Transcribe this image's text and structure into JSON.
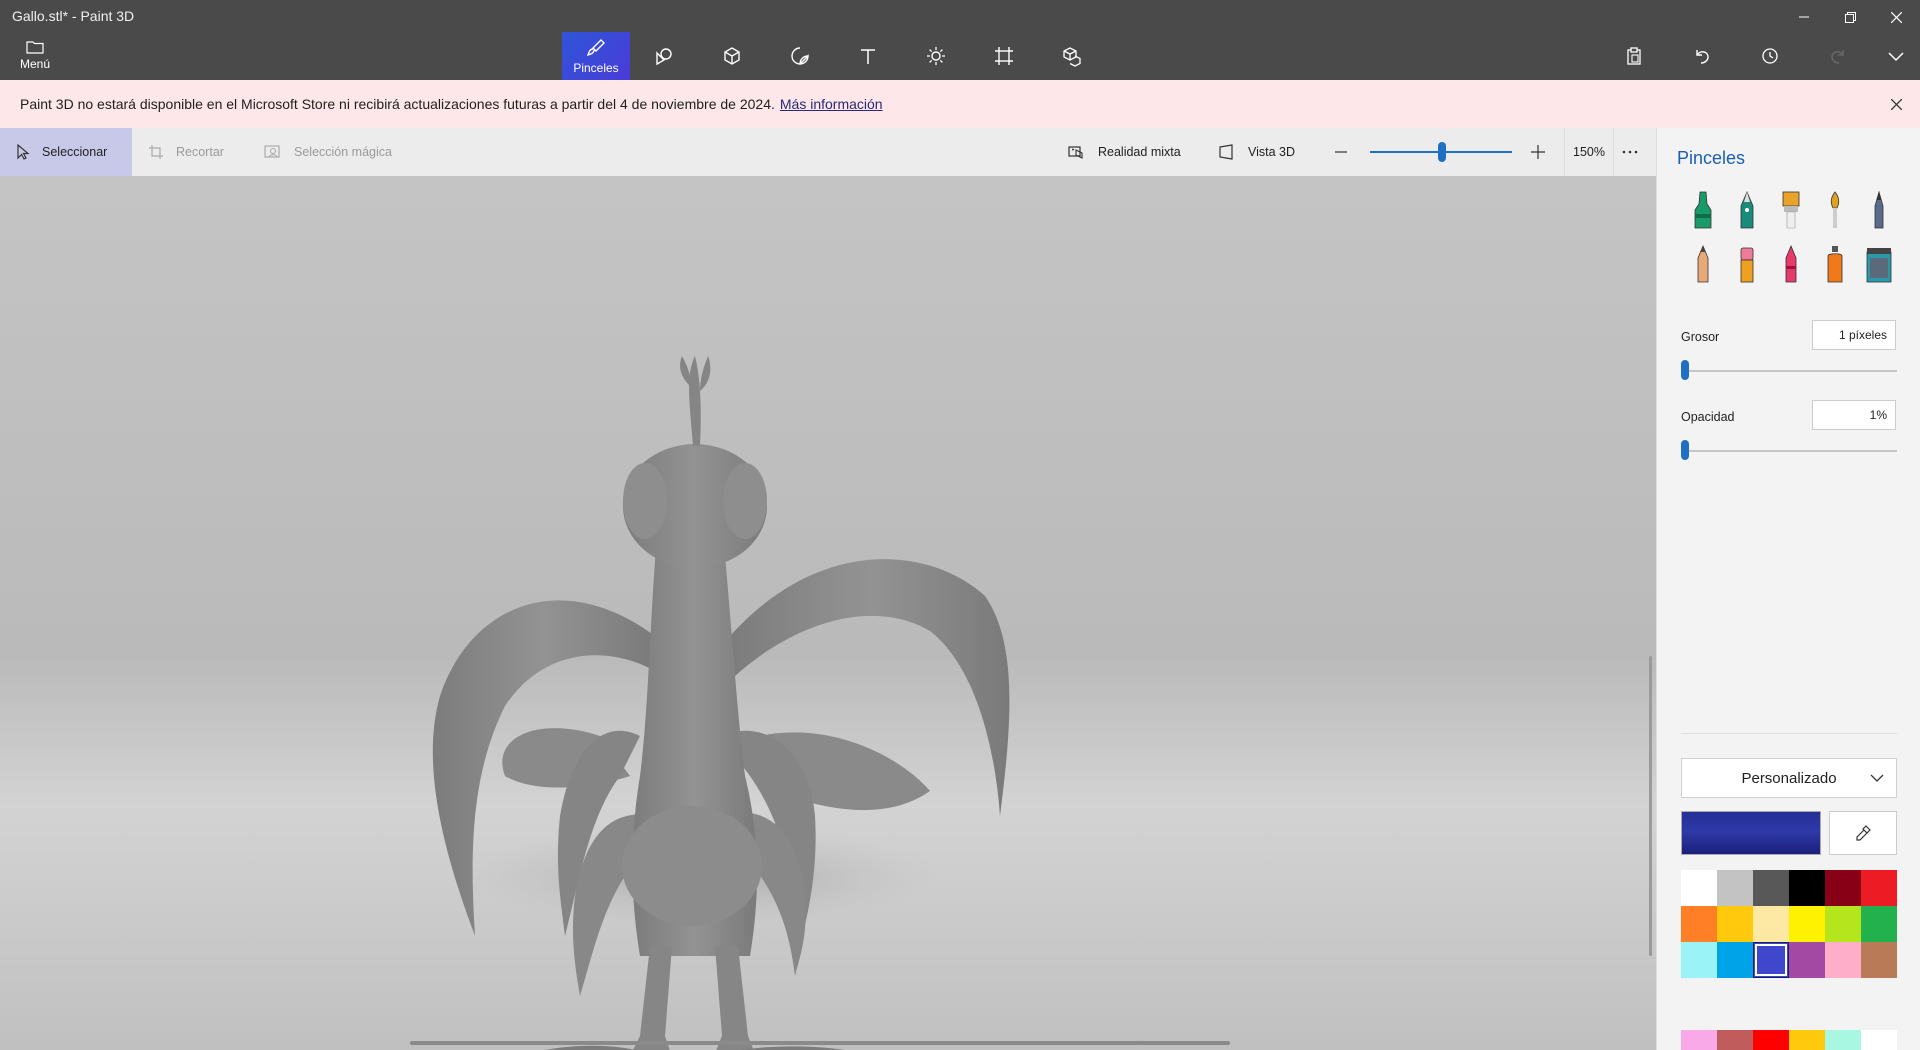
{
  "window": {
    "title": "Gallo.stl* - Paint 3D",
    "controls": [
      "minimize-icon",
      "restore-icon",
      "close-icon"
    ]
  },
  "menu": {
    "label": "Menú",
    "icon": "folder-icon"
  },
  "toolbar": {
    "tools": [
      {
        "name": "brushes",
        "label": "Pinceles",
        "icon": "brush-icon",
        "active": true
      },
      {
        "name": "2d-shapes",
        "label": "",
        "icon": "2d-shapes-icon",
        "active": false
      },
      {
        "name": "3d-shapes",
        "label": "",
        "icon": "cube-icon",
        "active": false
      },
      {
        "name": "stickers",
        "label": "",
        "icon": "sticker-icon",
        "active": false
      },
      {
        "name": "text",
        "label": "",
        "icon": "text-icon",
        "active": false
      },
      {
        "name": "effects",
        "label": "",
        "icon": "sun-icon",
        "active": false
      },
      {
        "name": "canvas",
        "label": "",
        "icon": "crop-canvas-icon",
        "active": false
      },
      {
        "name": "3d-library",
        "label": "",
        "icon": "3d-library-icon",
        "active": false
      }
    ],
    "right_icons": [
      "paste-icon",
      "undo-icon",
      "history-icon",
      "redo-icon",
      "expand-chevron-icon"
    ]
  },
  "notice": {
    "text": "Paint 3D no estará disponible en el Microsoft Store ni recibirá actualizaciones futuras a partir del 4 de noviembre de 2024.",
    "link": "Más información"
  },
  "subbar": {
    "select": "Seleccionar",
    "crop": "Recortar",
    "magic_select": "Selección mágica",
    "mixed_reality": "Realidad mixta",
    "view_3d": "Vista 3D",
    "zoom": "150%"
  },
  "panel": {
    "title": "Pinceles",
    "brushes": [
      {
        "name": "marker",
        "icon": "marker-icon",
        "color": "#1a9a6a"
      },
      {
        "name": "calligraphy-pen",
        "icon": "calligraphy-pen-icon",
        "color": "#1a8a7a"
      },
      {
        "name": "oil-brush",
        "icon": "oil-brush-icon",
        "color": "#e8a32a"
      },
      {
        "name": "watercolor",
        "icon": "watercolor-brush-icon",
        "color": "#e0a020"
      },
      {
        "name": "pixel-pen",
        "icon": "pixel-pen-icon",
        "color": "#5a6a8a"
      },
      {
        "name": "pencil",
        "icon": "pencil-icon",
        "color": "#e8a878"
      },
      {
        "name": "eraser",
        "icon": "eraser-icon",
        "color": "#f07a9a"
      },
      {
        "name": "crayon",
        "icon": "crayon-icon",
        "color": "#e83a6a"
      },
      {
        "name": "spray-can",
        "icon": "spray-can-icon",
        "color": "#f07a1a"
      },
      {
        "name": "fill",
        "icon": "fill-bucket-icon",
        "color": "#2a9aaa"
      }
    ],
    "thickness_label": "Grosor",
    "thickness_value": "1 píxeles",
    "thickness_level": 0.01,
    "opacity_label": "Opacidad",
    "opacity_value": "1%",
    "opacity_level": 0.01,
    "preset": "Personalizado",
    "current_color": "#262e96",
    "palette": [
      "#ffffff",
      "#c3c3c3",
      "#585858",
      "#000000",
      "#880015",
      "#ed1c24",
      "#ff7f27",
      "#ffc90e",
      "#fde8a4",
      "#fff200",
      "#b5e61d",
      "#22b14c",
      "#99f3f7",
      "#00a2e8",
      "#3f48cc",
      "#a349a4",
      "#ffaec9",
      "#b97a57"
    ],
    "palette_selected": 14,
    "custom_colors": [
      "#f9a8e8",
      "#c15c5c",
      "#ff0000",
      "#ffc90e",
      "#a8f7e2",
      "#ffffff"
    ]
  }
}
